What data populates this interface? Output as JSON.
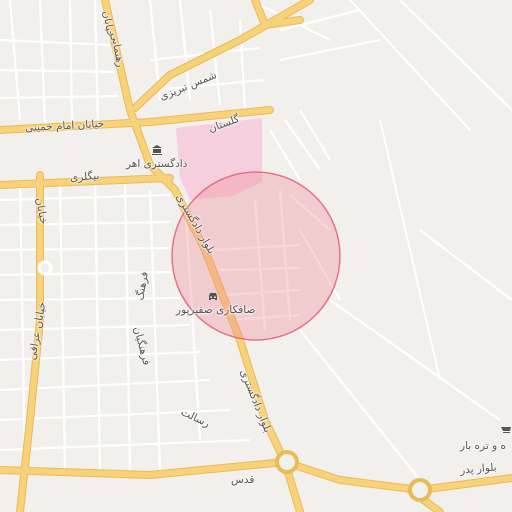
{
  "map": {
    "colors": {
      "background": "#f2f0ed",
      "major_road": "#f7d27a",
      "major_road_casing": "#e9bb55",
      "minor_road": "#ffffff",
      "minor_road_casing": "#d8d5d0",
      "pink_zone": "#f7c9dc",
      "radius_fill": "#f08a98",
      "radius_stroke": "#e25a6c"
    },
    "labels": {
      "shams_tabrizi": "شمس تبریزی",
      "imam_khomeini": "خیابان امام خمینی",
      "golestan": "گلستان",
      "dadgostari_ahar": "دادگستری اهر",
      "beygladi": "بیگلری",
      "blvd_dadgostari_top": "بلوار دادگستری",
      "farhang": "فرهنگ",
      "farhangian": "فرهنگیان",
      "safkari_safirpour": "صافکاری صفیرپور",
      "blvd_dadgostari_bottom": "بلوار دادگستری",
      "resalat": "رسالت",
      "quds": "قدس",
      "blvd_pard": "بلوار پدر",
      "tare_bar": "ه و تره بار",
      "khiaban_left": "خیابان",
      "khiaban_top": "خیابان",
      "iraqi": "خیابان عراقی",
      "rahnamai": "رهنمایی"
    },
    "icons": {
      "court": "bank-icon",
      "car_repair": "car-icon",
      "market": "market-icon"
    },
    "search_radius": {
      "visible": true
    }
  }
}
